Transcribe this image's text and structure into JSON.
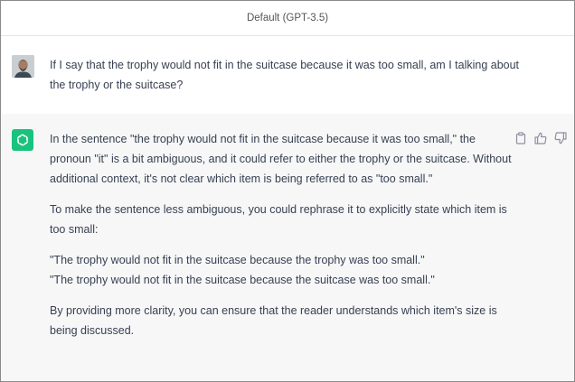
{
  "header": {
    "model_label": "Default (GPT-3.5)"
  },
  "user_message": {
    "avatar": "user-photo",
    "text": "If I say that the trophy would not fit in the suitcase because it was too small, am I talking about the trophy or the suitcase?"
  },
  "assistant_message": {
    "logo": "openai-logo",
    "paragraphs": [
      "In the sentence \"the trophy would not fit in the suitcase because it was too small,\" the pronoun \"it\" is a bit ambiguous, and it could refer to either the trophy or the suitcase. Without additional context, it's not clear which item is being referred to as \"too small.\"",
      "To make the sentence less ambiguous, you could rephrase it to explicitly state which item is too small:",
      "\"The trophy would not fit in the suitcase because the trophy was too small.\"",
      "\"The trophy would not fit in the suitcase because the suitcase was too small.\"",
      "By providing more clarity, you can ensure that the reader understands which item's size is being discussed."
    ],
    "actions": [
      "clipboard-icon",
      "thumbs-up-icon",
      "thumbs-down-icon"
    ]
  },
  "colors": {
    "assistant_bg": "#f7f7f8",
    "logo_bg": "#19c37d",
    "text": "#374151"
  }
}
